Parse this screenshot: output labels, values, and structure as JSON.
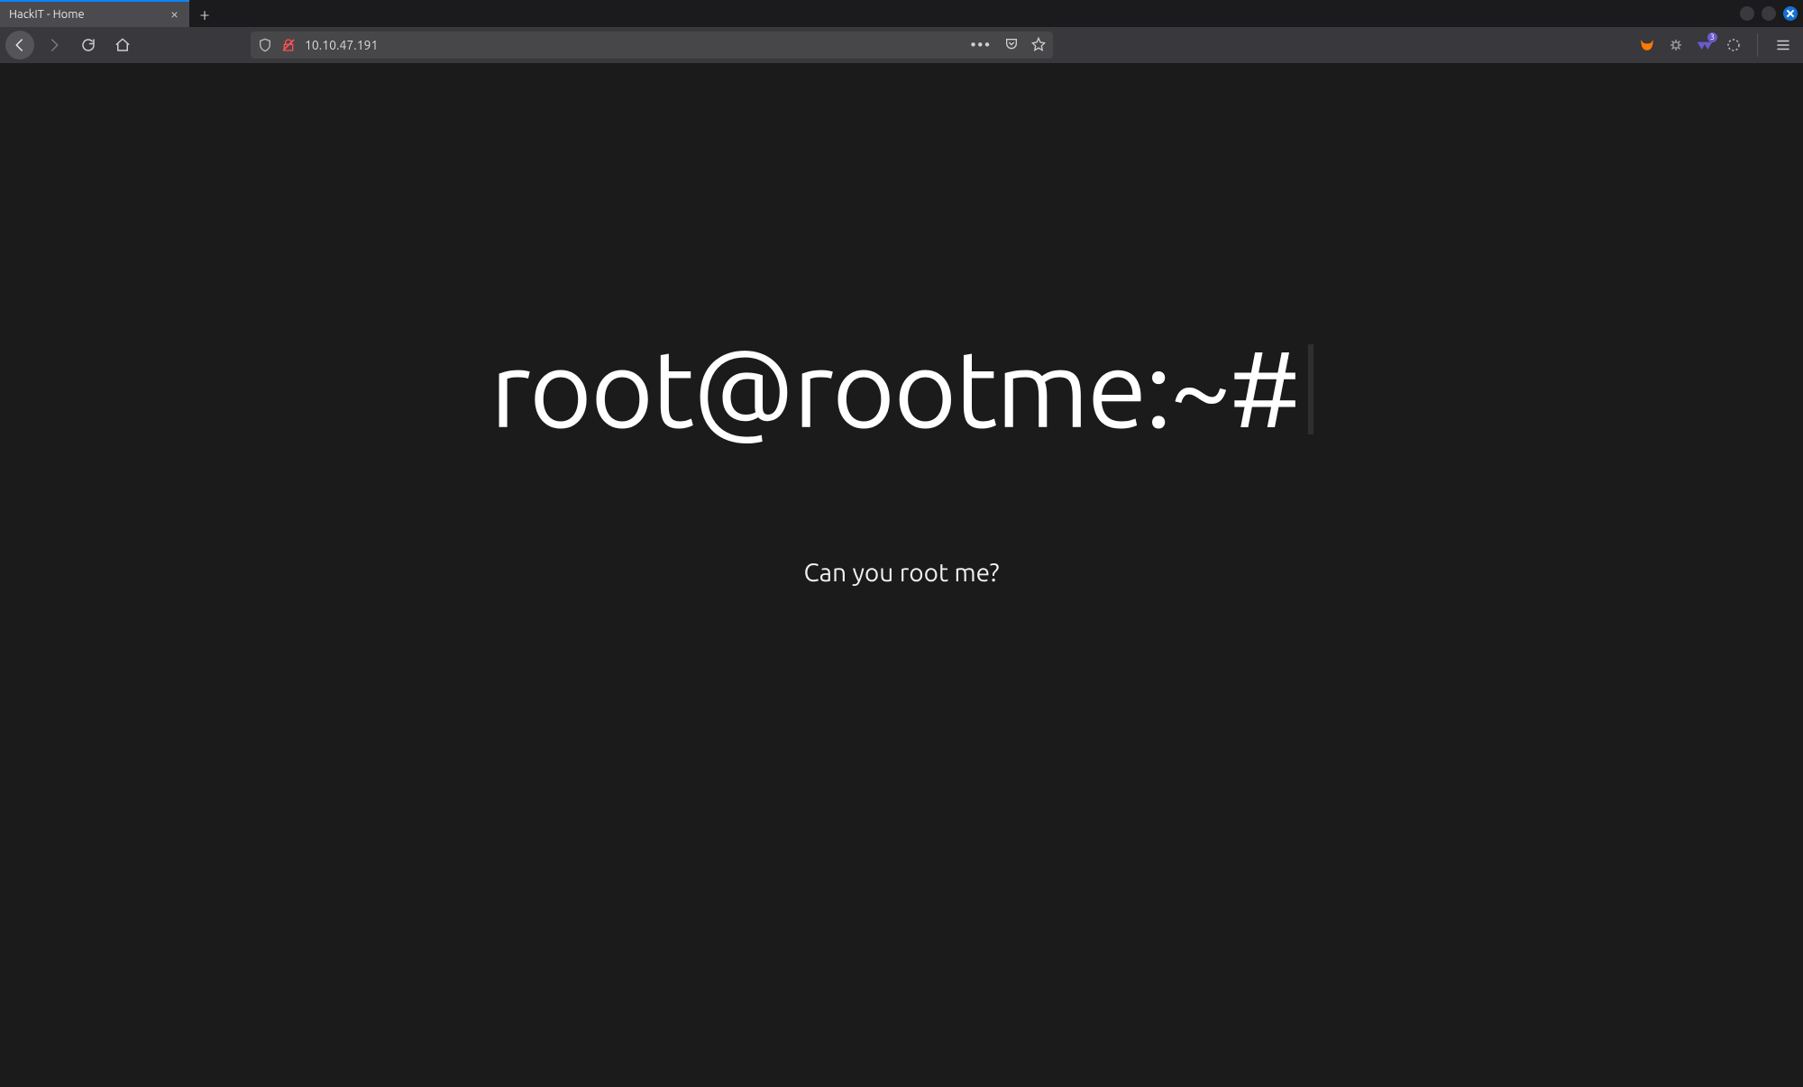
{
  "tabs": {
    "active_title": "HackIT - Home",
    "close_glyph": "×",
    "newtab_glyph": "+"
  },
  "window_controls": {
    "minimize": "minimize",
    "maximize": "maximize",
    "close": "close"
  },
  "nav": {
    "back": "back",
    "forward": "forward",
    "reload": "reload",
    "home": "home"
  },
  "urlbar": {
    "address": "10.10.47.191",
    "menu_dots": "•••"
  },
  "extensions": {
    "badge_count": "3"
  },
  "page": {
    "heading": "root@rootme:~#",
    "tagline": "Can you root me?"
  }
}
